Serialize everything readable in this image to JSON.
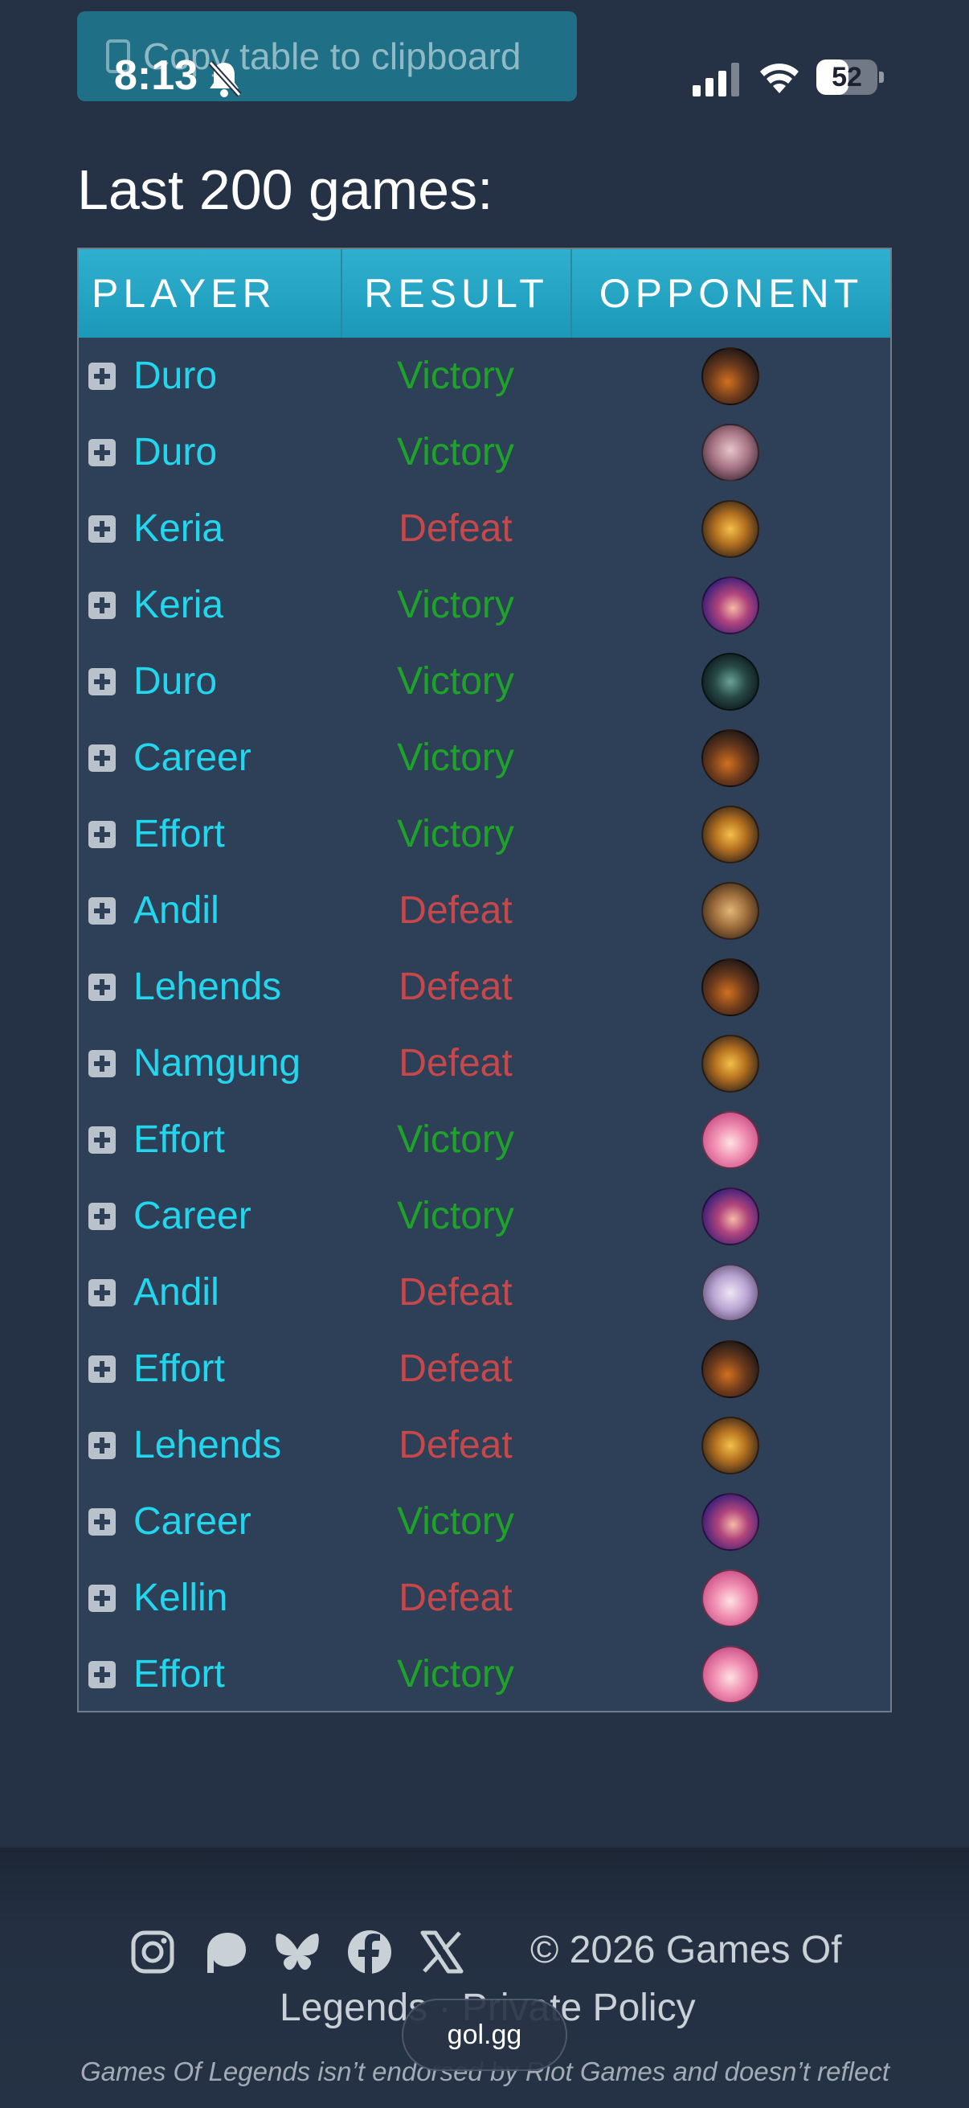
{
  "copy_button": {
    "label": "Copy table to clipboard"
  },
  "status_bar": {
    "time": "8:13",
    "battery": "52",
    "battery_level": 0.52
  },
  "page": {
    "title": "Last 200 games:"
  },
  "table": {
    "headers": {
      "player": "PLAYER",
      "result": "RESULT",
      "opponent": "OPPONENT"
    },
    "rows": [
      {
        "player": "Duro",
        "result": "Victory",
        "opponent_icon": "champion-icon-dark-orange"
      },
      {
        "player": "Duro",
        "result": "Victory",
        "opponent_icon": "champion-icon-pale-pink"
      },
      {
        "player": "Keria",
        "result": "Defeat",
        "opponent_icon": "champion-icon-gold-mech"
      },
      {
        "player": "Keria",
        "result": "Victory",
        "opponent_icon": "champion-icon-purple-hair"
      },
      {
        "player": "Duro",
        "result": "Victory",
        "opponent_icon": "champion-icon-dark-teal"
      },
      {
        "player": "Career",
        "result": "Victory",
        "opponent_icon": "champion-icon-dark-orange"
      },
      {
        "player": "Effort",
        "result": "Victory",
        "opponent_icon": "champion-icon-gold-mech"
      },
      {
        "player": "Andil",
        "result": "Defeat",
        "opponent_icon": "champion-icon-tan"
      },
      {
        "player": "Lehends",
        "result": "Defeat",
        "opponent_icon": "champion-icon-dark-orange"
      },
      {
        "player": "Namgung",
        "result": "Defeat",
        "opponent_icon": "champion-icon-gold-mech"
      },
      {
        "player": "Effort",
        "result": "Victory",
        "opponent_icon": "champion-icon-pink-hair"
      },
      {
        "player": "Career",
        "result": "Victory",
        "opponent_icon": "champion-icon-purple-hair"
      },
      {
        "player": "Andil",
        "result": "Defeat",
        "opponent_icon": "champion-icon-lavender"
      },
      {
        "player": "Effort",
        "result": "Defeat",
        "opponent_icon": "champion-icon-dark-orange"
      },
      {
        "player": "Lehends",
        "result": "Defeat",
        "opponent_icon": "champion-icon-gold-mech"
      },
      {
        "player": "Career",
        "result": "Victory",
        "opponent_icon": "champion-icon-purple-hair"
      },
      {
        "player": "Kellin",
        "result": "Defeat",
        "opponent_icon": "champion-icon-pink-hair"
      },
      {
        "player": "Effort",
        "result": "Victory",
        "opponent_icon": "champion-icon-pink-hair"
      }
    ]
  },
  "footer": {
    "social": [
      "instagram-icon",
      "patreon-icon",
      "bluesky-icon",
      "facebook-icon",
      "x-icon"
    ],
    "copyright": "© 2026 Games Of",
    "policy": "Legends · Private Policy",
    "disclaimer": "Games Of Legends isn’t endorsed by Riot Games and doesn’t reflect"
  },
  "browser": {
    "domain": "gol.gg"
  },
  "colors": {
    "victory": "#1ea22a",
    "defeat": "#c7484b",
    "player_link": "#22d6ee",
    "header_bg": "#1c98b8"
  }
}
